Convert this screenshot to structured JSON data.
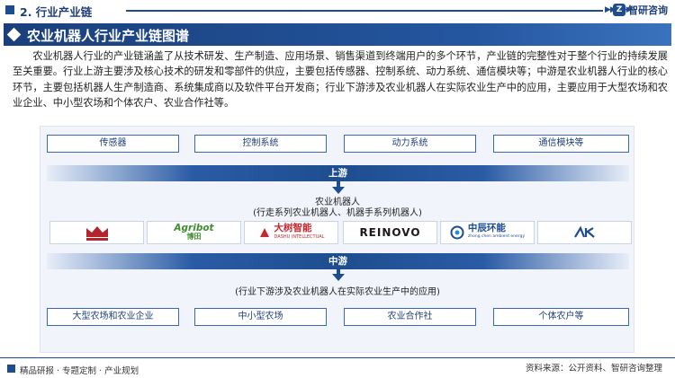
{
  "header": {
    "section_title": "2. 行业产业链",
    "brand": "智研咨询"
  },
  "title": "农业机器人行业产业链图谱",
  "paragraph": "农业机器人行业的产业链涵盖了从技术研发、生产制造、应用场景、销售渠道到终端用户的多个环节，产业链的完整性对于整个行业的持续发展至关重要。行业上游主要涉及核心技术的研发和零部件的供应，主要包括传感器、控制系统、动力系统、通信模块等；中游是农业机器人行业的核心环节，主要包括机器人生产制造商、系统集成商以及软件平台开发商；行业下游涉及农业机器人在实际农业生产中的应用，主要应用于大型农场和农业企业、中小型农场和个体农户、农业合作社等。",
  "diagram": {
    "upstream_items": [
      "传感器",
      "控制系统",
      "动力系统",
      "通信模块等"
    ],
    "upstream_label": "上游",
    "midstream_title": "农业机器人",
    "midstream_subtitle": "(行走系列农业机器人、机器手系列机器人)",
    "midstream_logos": [
      {
        "name": "crown-logo",
        "text": "",
        "color": "#b3262e"
      },
      {
        "name": "agribot-logo",
        "text": "Agribot",
        "sub": "博田",
        "color": "#3f8f2f"
      },
      {
        "name": "dashu-logo",
        "text": "大树智能",
        "sub": "DASHU INTELLECTUAL",
        "color": "#c8282d"
      },
      {
        "name": "reinovo-logo",
        "text": "REINOVO",
        "color": "#1a1a1a"
      },
      {
        "name": "zhongchen-logo",
        "text": "中辰环能",
        "sub": "zhong chen ambient energy",
        "color": "#1e4d8f"
      },
      {
        "name": "ak-logo",
        "text": "",
        "color": "#1e4d8f"
      }
    ],
    "midstream_label": "中游",
    "downstream_title": "(行业下游涉及农业机器人在实际农业生产中的应用)",
    "downstream_items": [
      "大型农场和农业企业",
      "中小型农场",
      "农业合作社",
      "个体农户等"
    ]
  },
  "footer": {
    "left": "精品研报 · 专题定制 · 产业规划",
    "source": "资料来源：公开资料、智研咨询整理"
  },
  "colors": {
    "primary": "#1e4d8f",
    "accent": "#2a5ba5"
  }
}
